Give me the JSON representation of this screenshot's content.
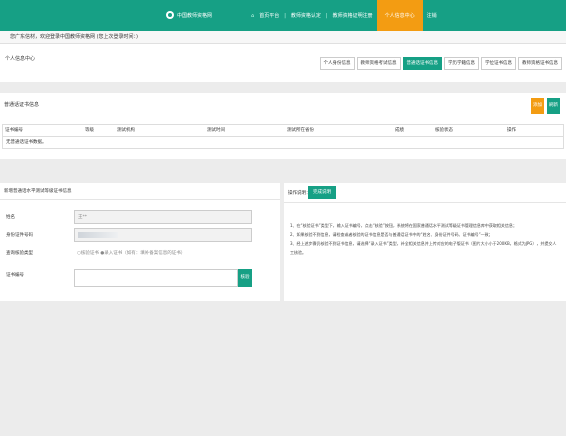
{
  "header": {
    "logo_text": "中国教师资格网",
    "nav": [
      "首页平台",
      "教师资格认定",
      "教师资格证明注册",
      "个人信息中心",
      "注销"
    ],
    "active_index": 3,
    "brand_color": "#16a085",
    "active_color": "#f39c12"
  },
  "welcome": "您广东信材，欢迎登录中国教师资格网 (您上次登录时间：)",
  "personal": {
    "title": "个人信息中心",
    "tabs": [
      "个人身份信息",
      "教师资格考试信息",
      "普通话证书信息",
      "学历学籍信息",
      "学位证书信息",
      "教师资格证书信息"
    ],
    "active_tab": 2
  },
  "cert": {
    "title": "普通话证书信息",
    "btn_add": "添加",
    "btn_refresh": "刷新",
    "columns": [
      "证书编号",
      "等级",
      "测试机构",
      "测试时间",
      "测试所在省份",
      "成绩",
      "核验状态",
      "操作"
    ],
    "empty_row": "无普通话证书数据。"
  },
  "form": {
    "title": "新增普通话水平测试等级证书信息",
    "name_label": "姓名",
    "name_value": "王**",
    "id_label": "身份证件号码",
    "verify_type_label": "查询核验类型",
    "verify_type_value": "○核验证书 ●录入证书（如有：填补备案信息的证书）",
    "cert_no_label": "证书编号",
    "verify_btn": "核验"
  },
  "note": {
    "label": "操作说明：",
    "button": "完成说明",
    "lines": [
      "1、在“核验证书”类型下，输入证书编号，点击“核验”按钮，系统将在国家普通话水平测试等级证书管理信息库中获取相关信息；",
      "2、如果核验不到信息，请检查或者核验的证书信息是否与普通话证书中的“姓名、身份证件号码、证书编号”一致；",
      "3、经上述步骤仍核验不到证书信息，请选择“录入证书”类型，补全相关信息并上传对应的电子版证书（图片大小小于200KB，格式为JPG），并提交人工核验。"
    ]
  }
}
